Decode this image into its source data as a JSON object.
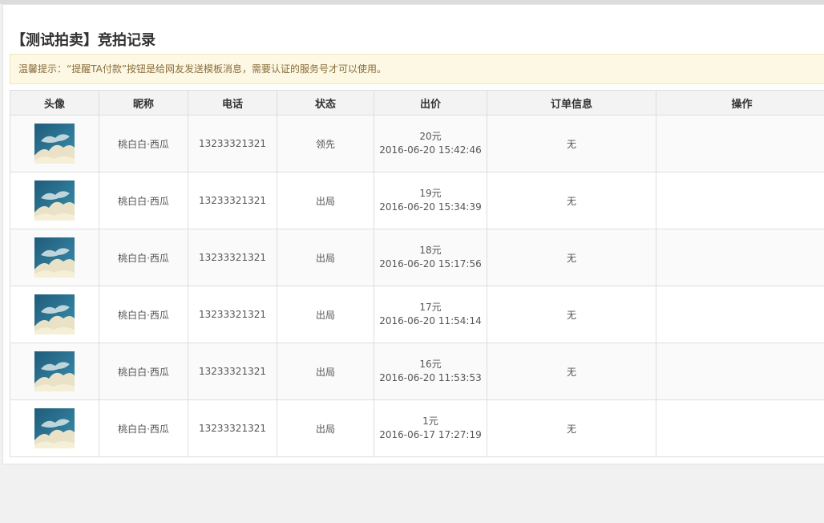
{
  "page": {
    "title": "【测试拍卖】竞拍记录",
    "notice": "温馨提示：“提醒TA付款”按钮是给网友发送模板消息，需要认证的服务号才可以使用。"
  },
  "table": {
    "headers": {
      "avatar": "头像",
      "nickname": "昵称",
      "phone": "电话",
      "status": "状态",
      "bid": "出价",
      "order": "订单信息",
      "actions": "操作"
    },
    "rows": [
      {
        "nickname": "桃白白·西瓜",
        "phone": "13233321321",
        "status": "领先",
        "amount": "20元",
        "time": "2016-06-20 15:42:46",
        "order": "无"
      },
      {
        "nickname": "桃白白·西瓜",
        "phone": "13233321321",
        "status": "出局",
        "amount": "19元",
        "time": "2016-06-20 15:34:39",
        "order": "无"
      },
      {
        "nickname": "桃白白·西瓜",
        "phone": "13233321321",
        "status": "出局",
        "amount": "18元",
        "time": "2016-06-20 15:17:56",
        "order": "无"
      },
      {
        "nickname": "桃白白·西瓜",
        "phone": "13233321321",
        "status": "出局",
        "amount": "17元",
        "time": "2016-06-20 11:54:14",
        "order": "无"
      },
      {
        "nickname": "桃白白·西瓜",
        "phone": "13233321321",
        "status": "出局",
        "amount": "16元",
        "time": "2016-06-20 11:53:53",
        "order": "无"
      },
      {
        "nickname": "桃白白·西瓜",
        "phone": "13233321321",
        "status": "出局",
        "amount": "1元",
        "time": "2016-06-17 17:27:19",
        "order": "无"
      }
    ]
  }
}
